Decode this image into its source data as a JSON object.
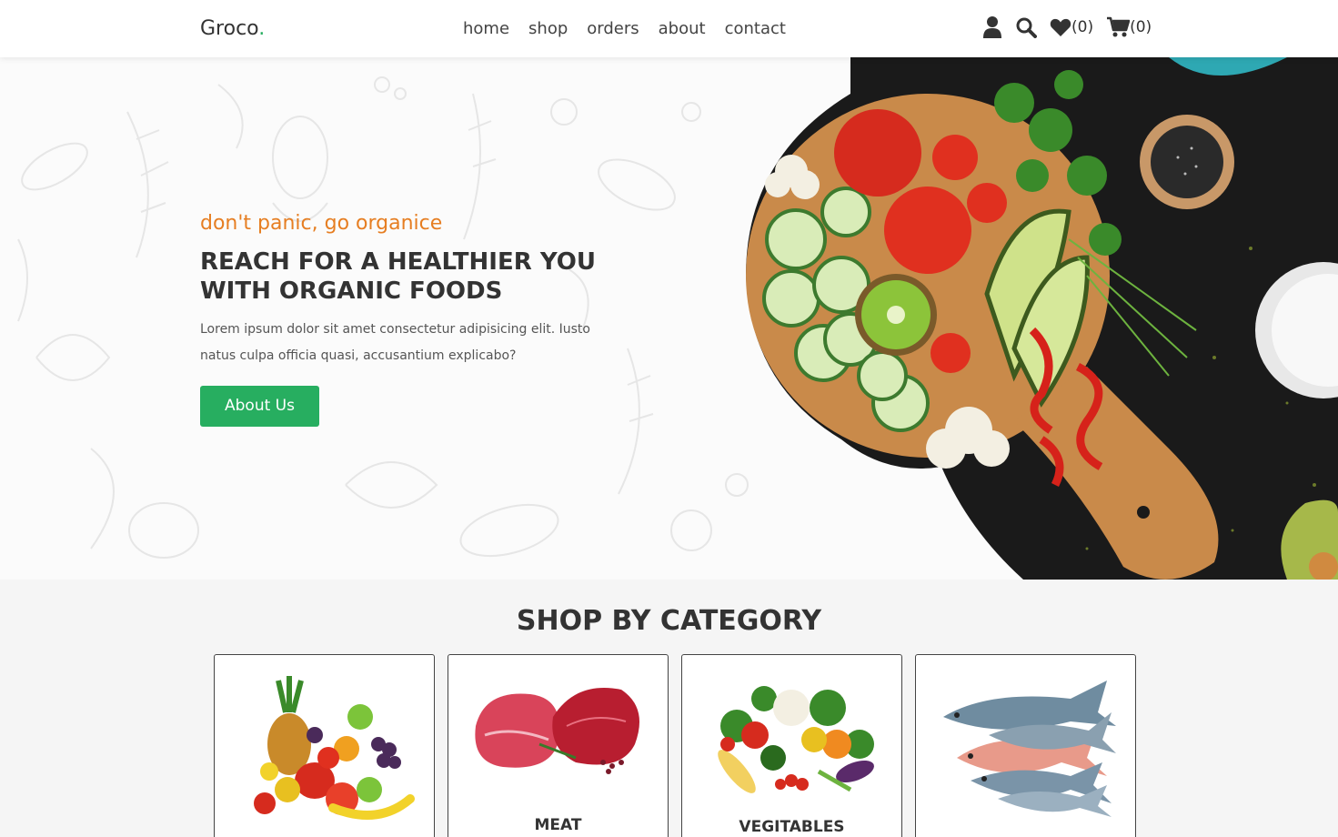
{
  "brand": {
    "name": "Groco",
    "dot": "."
  },
  "nav": {
    "items": [
      "home",
      "shop",
      "orders",
      "about",
      "contact"
    ]
  },
  "header_icons": {
    "user": "user-icon",
    "search": "search-icon",
    "wishlist": {
      "icon": "heart-icon",
      "count": "(0)"
    },
    "cart": {
      "icon": "cart-icon",
      "count": "(0)"
    }
  },
  "hero": {
    "tagline": "don't panic, go organice",
    "headline_line1": "REACH FOR A HEALTHIER YOU",
    "headline_line2": "WITH ORGANIC FOODS",
    "description": "Lorem ipsum dolor sit amet consectetur adipisicing elit. Iusto natus culpa officia quasi, accusantium explicabo?",
    "button": "About Us"
  },
  "categories": {
    "title": "SHOP BY CATEGORY",
    "items": [
      {
        "name": "",
        "image": "fruits"
      },
      {
        "name": "MEAT",
        "image": "meat"
      },
      {
        "name": "VEGITABLES",
        "image": "vegetables"
      },
      {
        "name": "",
        "image": "fish"
      }
    ]
  },
  "colors": {
    "accent": "#27ae60",
    "tagline": "#e67e22",
    "text": "#333333",
    "section_bg": "#f5f5f5"
  }
}
